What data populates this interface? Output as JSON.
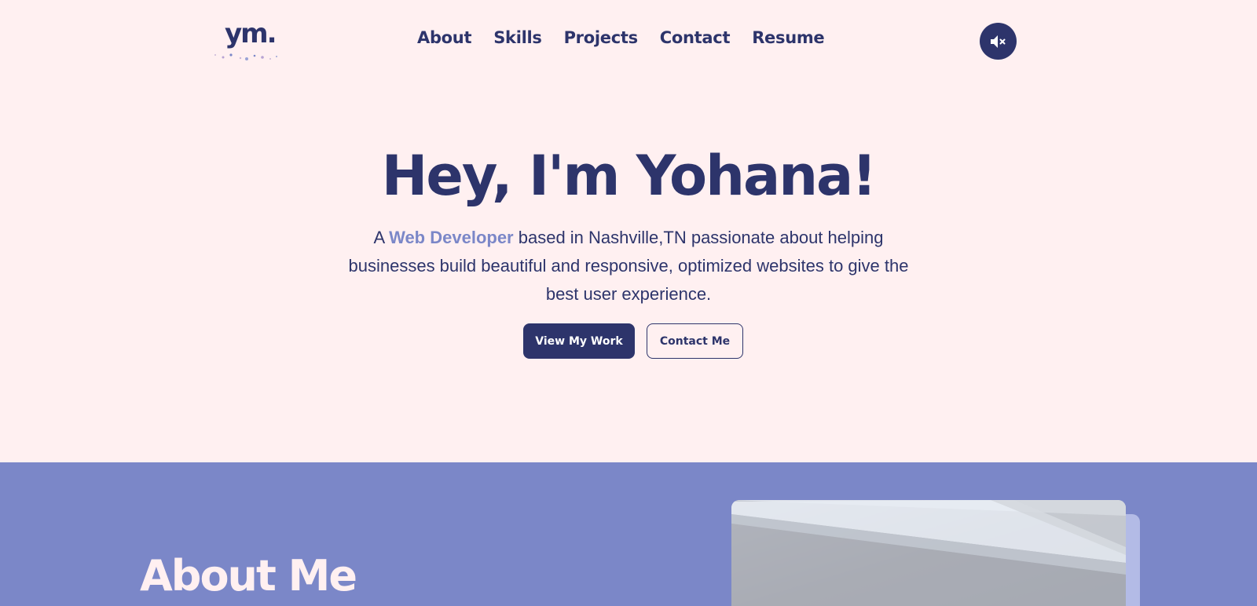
{
  "logo": {
    "text": "ym."
  },
  "nav": {
    "links": [
      "About",
      "Skills",
      "Projects",
      "Contact",
      "Resume"
    ],
    "sound_button_icon": "speaker-muted-icon"
  },
  "hero": {
    "title": "Hey, I'm Yohana!",
    "subtitle_prefix": "A ",
    "subtitle_highlight": "Web Developer",
    "subtitle_rest": " based in Nashville,TN passionate about helping businesses build beautiful and responsive, optimized websites to give the best user experience.",
    "primary_button": "View My Work",
    "secondary_button": "Contact Me"
  },
  "about": {
    "title": "About Me"
  },
  "colors": {
    "background": "#fff0f1",
    "navy": "#2d346b",
    "periwinkle": "#7b87c8",
    "photo_shadow": "#b3bbe6"
  }
}
